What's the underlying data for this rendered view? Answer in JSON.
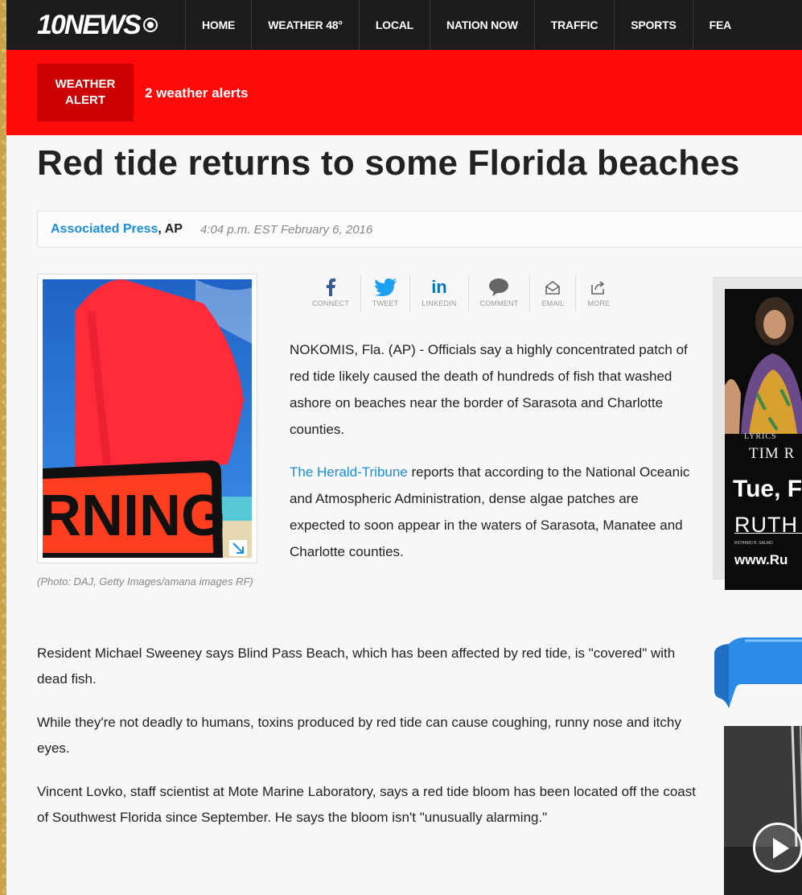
{
  "nav": {
    "logo": "10NEWS",
    "items": [
      "HOME",
      "WEATHER 48°",
      "LOCAL",
      "NATION NOW",
      "TRAFFIC",
      "SPORTS",
      "FEA"
    ]
  },
  "alert": {
    "box_line1": "WEATHER",
    "box_line2": "ALERT",
    "text": "2 weather alerts"
  },
  "article": {
    "headline": "Red tide returns to some Florida beaches",
    "author": "Associated Press",
    "agency": ", AP",
    "timestamp": "4:04 p.m. EST February 6, 2016",
    "photo_caption": "(Photo: DAJ, Getty Images/amana images RF)",
    "photo_sign_text": "RNING",
    "share": [
      {
        "label": "CONNECT",
        "icon": "facebook-icon"
      },
      {
        "label": "TWEET",
        "icon": "twitter-icon"
      },
      {
        "label": "LINKEDIN",
        "icon": "linkedin-icon"
      },
      {
        "label": "COMMENT",
        "icon": "comment-icon"
      },
      {
        "label": "EMAIL",
        "icon": "email-icon"
      },
      {
        "label": "MORE",
        "icon": "share-icon"
      }
    ],
    "p1": "NOKOMIS, Fla. (AP) - Officials say a highly concentrated patch of red tide likely caused the death of hundreds of fish that washed ashore on beaches near the border of Sarasota and Charlotte counties.",
    "p2_link": "The Herald-Tribune",
    "p2_rest": " reports that according to the National Oceanic and Atmospheric Administration, dense algae patches are expected to soon appear in the waters of Sarasota, Manatee and Charlotte counties.",
    "p3": "Resident Michael Sweeney says Blind Pass Beach, which has been affected by red tide, is \"covered\" with dead fish.",
    "p4": "While they're not deadly to humans, toxins produced by red tide can cause coughing, runny nose and itchy eyes.",
    "p5": "Vincent Lovko, staff scientist at Mote Marine Laboratory, says a red tide bloom has been located off the coast of Southwest Florida since September. He says the bloom isn't \"unusually alarming.\""
  },
  "ad": {
    "lyrics": "LYRICS",
    "tim": "TIM R",
    "tue": "Tue, F",
    "ruth": "RUTH E",
    "richard": "RICHARD B. SALMO",
    "www": "www.Ru"
  },
  "colors": {
    "nav_bg": "#1c1c1c",
    "alert_red": "#ff0a0a",
    "alert_box": "#cc0000",
    "link_blue": "#1a8ed8"
  }
}
